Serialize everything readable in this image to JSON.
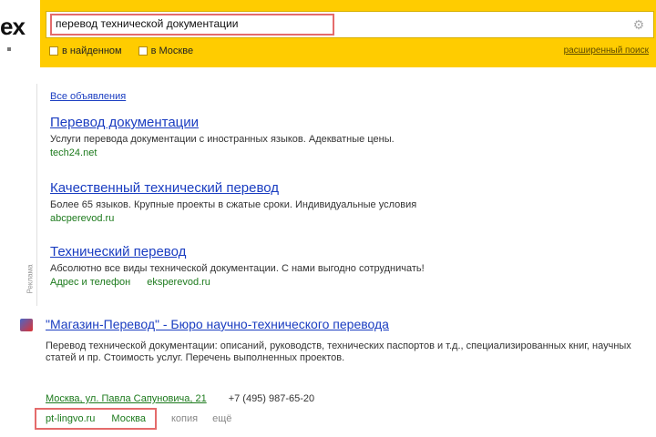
{
  "search": {
    "query": "перевод технической документации",
    "filters": [
      "в найденном",
      "в Москве"
    ],
    "advanced_label": "расширенный поиск",
    "settings_icon": "gear-icon"
  },
  "left_rail": {
    "logo_fragment": "ex",
    "vertical_label": "Реклама"
  },
  "ads": {
    "heading": "Все объявления",
    "items": [
      {
        "title": "Перевод документации",
        "text": "Услуги перевода документации с иностранных языков. Адекватные цены.",
        "url": "tech24.net"
      },
      {
        "title": "Качественный технический перевод",
        "text": "Более 65 языков. Крупные проекты в сжатые сроки. Индивидуальные условия",
        "url": "abcperevod.ru"
      },
      {
        "title": "Технический перевод",
        "text": "Абсолютно все виды технической документации. С нами выгодно сотрудничать!",
        "links": [
          "Адрес и телефон",
          "eksperevod.ru"
        ]
      }
    ]
  },
  "organic": {
    "title": "\"Магазин-Перевод\" - Бюро научно-технического перевода",
    "snippet": "Перевод технической документации: описаний, руководств, технических паспортов и т.д., специализированных книг, научных статей и пр. Стоимость услуг. Перечень выполненных проектов.",
    "address": "Москва, ул. Павла Сапуновича, 21",
    "phone": "+7 (495) 987-65-20",
    "site": "pt-lingvo.ru",
    "city": "Москва",
    "meta1": "копия",
    "meta2": "ещё"
  }
}
